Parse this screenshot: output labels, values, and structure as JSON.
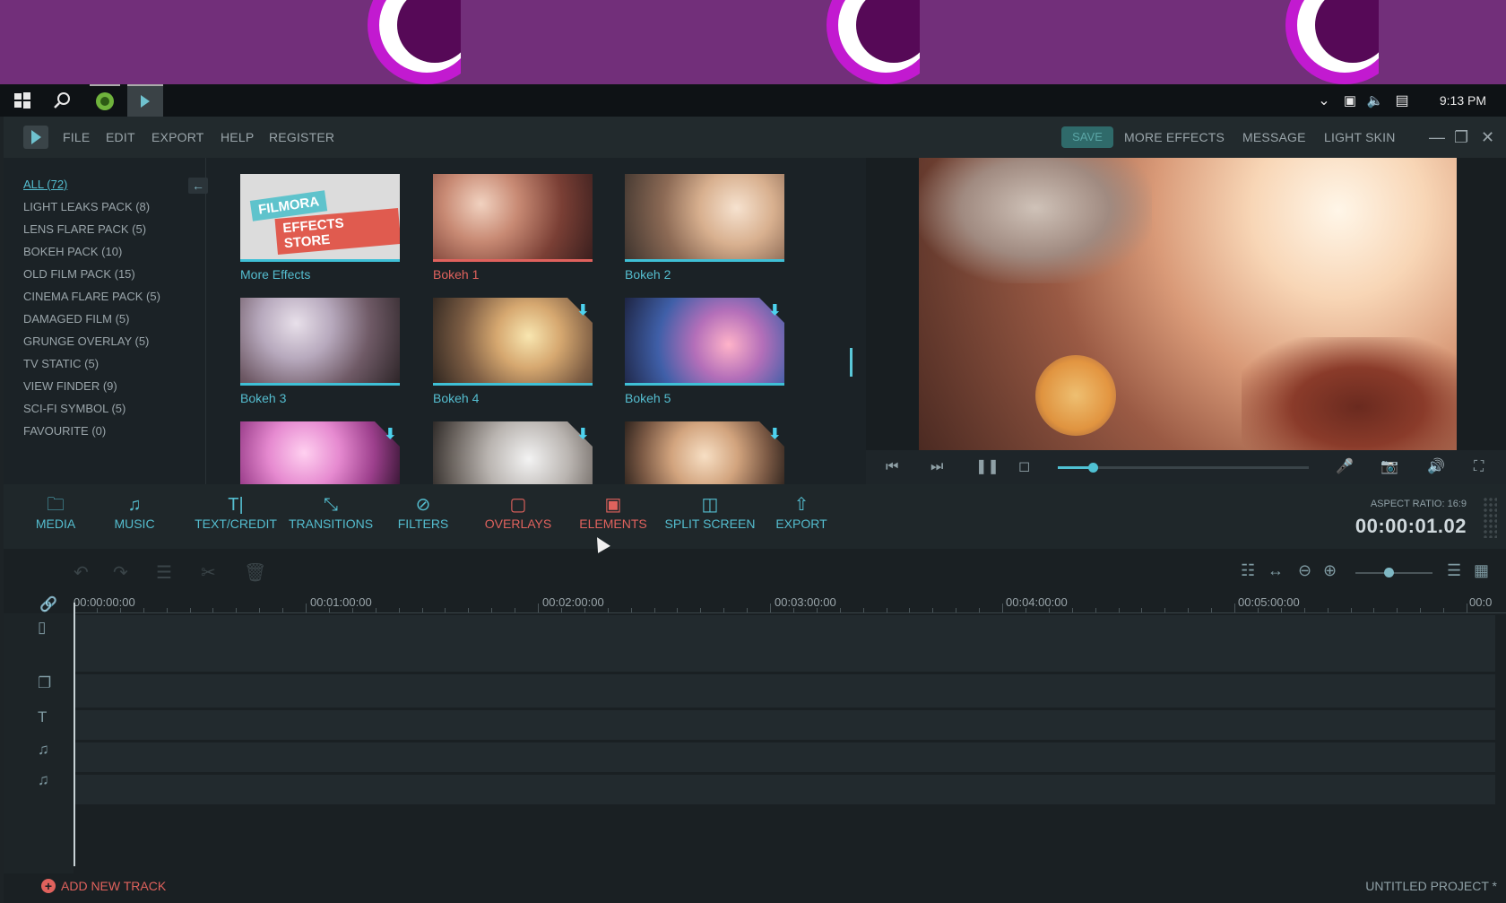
{
  "taskbar": {
    "clock": "9:13 PM",
    "icons": [
      "windows-start-icon",
      "search-icon",
      "upwork-icon",
      "filmora-app-icon"
    ],
    "tray_icons": [
      "chevron-down-icon",
      "network-icon",
      "volume-icon",
      "notification-icon"
    ]
  },
  "app": {
    "menu": [
      "FILE",
      "EDIT",
      "EXPORT",
      "HELP",
      "REGISTER"
    ],
    "save_label": "SAVE",
    "right_menu": [
      "MORE EFFECTS",
      "MESSAGE",
      "LIGHT SKIN"
    ]
  },
  "library": {
    "categories": [
      "ALL (72)",
      "LIGHT LEAKS PACK (8)",
      "LENS FLARE PACK (5)",
      "BOKEH PACK (10)",
      "OLD FILM PACK (15)",
      "CINEMA FLARE PACK (5)",
      "DAMAGED FILM (5)",
      "GRUNGE OVERLAY (5)",
      "TV STATIC (5)",
      "VIEW FINDER (9)",
      "SCI-FI SYMBOL (5)",
      "FAVOURITE (0)"
    ],
    "store_line1": "FILMORA",
    "store_line2": "EFFECTS STORE",
    "items": [
      {
        "label": "More Effects"
      },
      {
        "label": "Bokeh 1"
      },
      {
        "label": "Bokeh 2"
      },
      {
        "label": "Bokeh 3"
      },
      {
        "label": "Bokeh 4"
      },
      {
        "label": "Bokeh 5"
      }
    ]
  },
  "preview": {
    "progress": 0.14
  },
  "toolbar": {
    "tools": [
      "MEDIA",
      "MUSIC",
      "TEXT/CREDIT",
      "TRANSITIONS",
      "FILTERS",
      "OVERLAYS",
      "ELEMENTS",
      "SPLIT SCREEN",
      "EXPORT"
    ],
    "aspect_ratio": "ASPECT RATIO: 16:9",
    "timecode": "00:00:01.02"
  },
  "timeline": {
    "ruler": [
      "00:00:00:00",
      "00:01:00:00",
      "00:02:00:00",
      "00:03:00:00",
      "00:04:00:00",
      "00:05:00:00",
      "00:0"
    ],
    "add_track": "ADD NEW TRACK",
    "project_name": "UNTITLED PROJECT *"
  },
  "colors": {
    "banner": "#722f7a",
    "accent": "#54bdcf",
    "active_red": "#e0625d",
    "panel": "#1b2226"
  }
}
